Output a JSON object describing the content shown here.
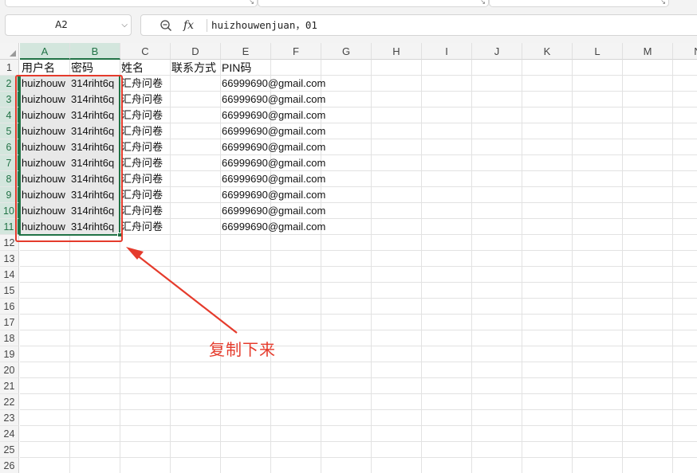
{
  "name_box": {
    "value": "A2"
  },
  "formula_bar": {
    "fx_label": "fx",
    "content": "huizhouwenjuan，01"
  },
  "columns": [
    "A",
    "B",
    "C",
    "D",
    "E",
    "F",
    "G",
    "H",
    "I",
    "J",
    "K",
    "L",
    "M",
    "N"
  ],
  "rows": [
    "1",
    "2",
    "3",
    "4",
    "5",
    "6",
    "7",
    "8",
    "9",
    "10",
    "11",
    "12",
    "13",
    "14",
    "15",
    "16",
    "17",
    "18",
    "19",
    "20",
    "21",
    "22",
    "23",
    "24",
    "25",
    "26"
  ],
  "header_row": {
    "a": "用户名",
    "b": "密码",
    "c": "姓名",
    "d": "联系方式",
    "e": "PIN码"
  },
  "data_rows": [
    {
      "a": "huizhouw",
      "b": "314riht6q",
      "c": "汇舟问卷",
      "e": "66999690@gmail.com"
    },
    {
      "a": "huizhouw",
      "b": "314riht6q",
      "c": "汇舟问卷",
      "e": "66999690@gmail.com"
    },
    {
      "a": "huizhouw",
      "b": "314riht6q",
      "c": "汇舟问卷",
      "e": "66999690@gmail.com"
    },
    {
      "a": "huizhouw",
      "b": "314riht6q",
      "c": "汇舟问卷",
      "e": "66999690@gmail.com"
    },
    {
      "a": "huizhouw",
      "b": "314riht6q",
      "c": "汇舟问卷",
      "e": "66999690@gmail.com"
    },
    {
      "a": "huizhouw",
      "b": "314riht6q",
      "c": "汇舟问卷",
      "e": "66999690@gmail.com"
    },
    {
      "a": "huizhouw",
      "b": "314riht6q",
      "c": "汇舟问卷",
      "e": "66999690@gmail.com"
    },
    {
      "a": "huizhouw",
      "b": "314riht6q",
      "c": "汇舟问卷",
      "e": "66999690@gmail.com"
    },
    {
      "a": "huizhouw",
      "b": "314riht6q",
      "c": "汇舟问卷",
      "e": "66999690@gmail.com"
    },
    {
      "a": "huizhouw",
      "b": "314riht6q",
      "c": "汇舟问卷",
      "e": "66999690@gmail.com"
    }
  ],
  "annotation": {
    "text": "复制下来",
    "color": "#e53b2c"
  },
  "colors": {
    "accent": "#217346",
    "annotation": "#e53b2c",
    "selection_fill": "#e8e8e8"
  }
}
